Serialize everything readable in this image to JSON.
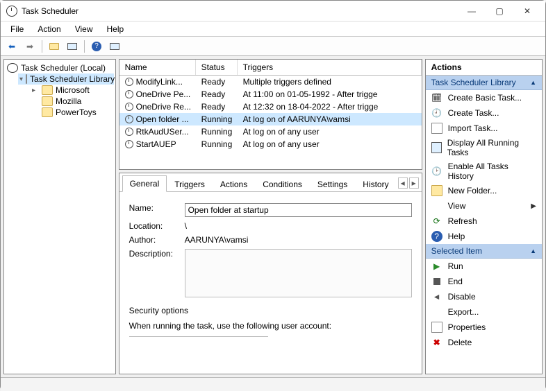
{
  "window": {
    "title": "Task Scheduler"
  },
  "menu": {
    "file": "File",
    "action": "Action",
    "view": "View",
    "help": "Help"
  },
  "tree": {
    "root": "Task Scheduler (Local)",
    "library": "Task Scheduler Library",
    "children": [
      {
        "label": "Microsoft"
      },
      {
        "label": "Mozilla"
      },
      {
        "label": "PowerToys"
      }
    ]
  },
  "columns": {
    "name": "Name",
    "status": "Status",
    "triggers": "Triggers"
  },
  "tasks": [
    {
      "name": "ModifyLink...",
      "status": "Ready",
      "trigger": "Multiple triggers defined"
    },
    {
      "name": "OneDrive Pe...",
      "status": "Ready",
      "trigger": "At 11:00 on 01-05-1992 - After trigge"
    },
    {
      "name": "OneDrive Re...",
      "status": "Ready",
      "trigger": "At 12:32 on 18-04-2022 - After trigge"
    },
    {
      "name": "Open folder ...",
      "status": "Running",
      "trigger": "At log on of AARUNYA\\vamsi",
      "selected": true
    },
    {
      "name": "RtkAudUSer...",
      "status": "Running",
      "trigger": "At log on of any user"
    },
    {
      "name": "StartAUEP",
      "status": "Running",
      "trigger": "At log on of any user"
    }
  ],
  "tabs": {
    "general": "General",
    "triggers": "Triggers",
    "actions": "Actions",
    "conditions": "Conditions",
    "settings": "Settings",
    "history": "History"
  },
  "details": {
    "name_label": "Name:",
    "name_value": "Open folder at startup",
    "location_label": "Location:",
    "location_value": "\\",
    "author_label": "Author:",
    "author_value": "AARUNYA\\vamsi",
    "description_label": "Description:",
    "security_title": "Security options",
    "security_text": "When running the task, use the following user account:"
  },
  "actions": {
    "pane_title": "Actions",
    "group1": "Task Scheduler Library",
    "g1": {
      "create_basic": "Create Basic Task...",
      "create_task": "Create Task...",
      "import": "Import Task...",
      "display_running": "Display All Running Tasks",
      "enable_history": "Enable All Tasks History",
      "new_folder": "New Folder...",
      "view": "View",
      "refresh": "Refresh",
      "help": "Help"
    },
    "group2": "Selected Item",
    "g2": {
      "run": "Run",
      "end": "End",
      "disable": "Disable",
      "export": "Export...",
      "properties": "Properties",
      "delete": "Delete"
    }
  }
}
